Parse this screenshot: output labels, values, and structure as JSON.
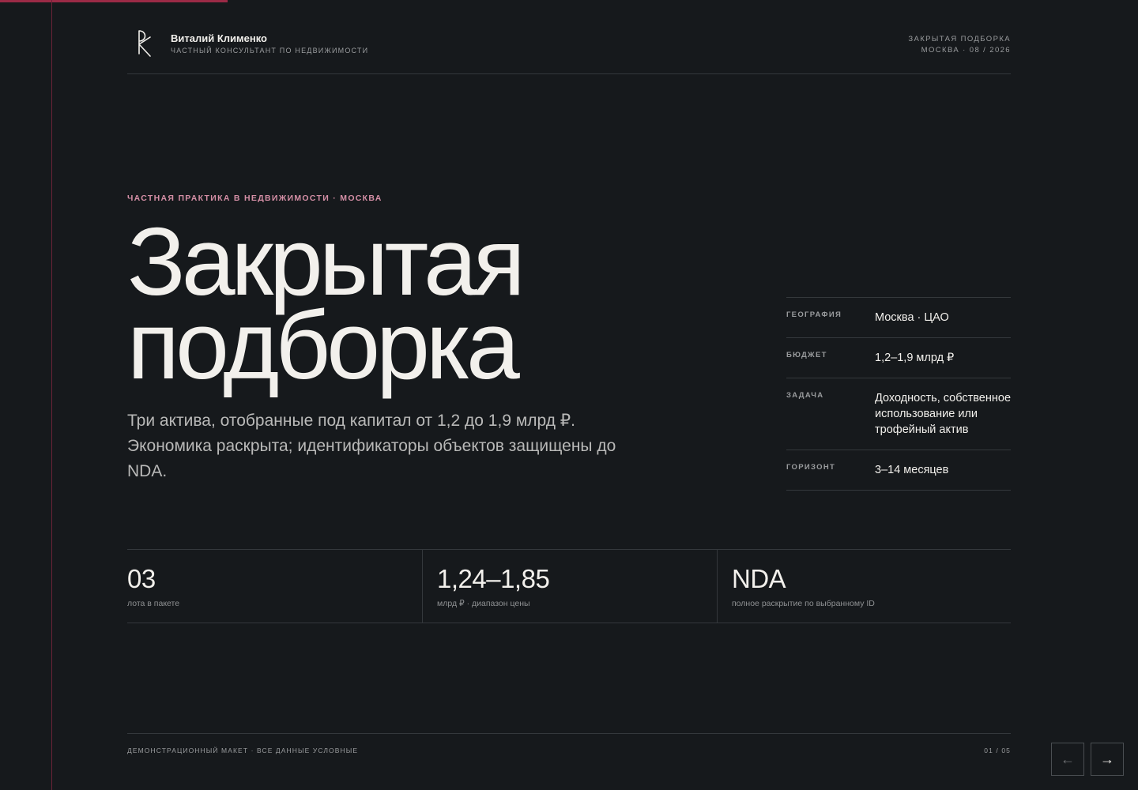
{
  "header": {
    "name": "Виталий Клименко",
    "subtitle": "частный консультант по недвижимости",
    "doc_title": "ЗАКРЫТАЯ ПОДБОРКА",
    "doc_meta": "МОСКВА · 08 / 2026"
  },
  "hero": {
    "eyebrow": "ЧАСТНАЯ ПРАКТИКА В НЕДВИЖИМОСТИ · МОСКВА",
    "title_line1": "Закрытая",
    "title_line2": "подборка",
    "lead": "Три актива, отобранные под капитал от 1,2 до 1,9 млрд ₽. Экономика раскрыта; идентификаторы объектов защищены до NDA."
  },
  "facts": [
    {
      "key": "ГЕОГРАФИЯ",
      "value": "Москва · ЦАО"
    },
    {
      "key": "БЮДЖЕТ",
      "value": "1,2–1,9 млрд ₽"
    },
    {
      "key": "ЗАДАЧА",
      "value": "Доходность, собственное использование или трофейный актив"
    },
    {
      "key": "ГОРИЗОНТ",
      "value": "3–14 месяцев"
    }
  ],
  "stats": [
    {
      "value": "03",
      "label": "лота в пакете"
    },
    {
      "value": "1,24–1,85",
      "label": "млрд ₽ · диапазон цены"
    },
    {
      "value": "NDA",
      "label": "полное раскрытие по выбранному ID"
    }
  ],
  "footer": {
    "note": "ДЕМОНСТРАЦИОННЫЙ МАКЕТ · ВСЕ ДАННЫЕ УСЛОВНЫЕ",
    "page": "01 / 05"
  },
  "nav": {
    "prev_icon": "arrow-left-icon",
    "next_icon": "arrow-right-icon",
    "prev_glyph": "←",
    "next_glyph": "→"
  },
  "progress": {
    "fraction": 0.2
  },
  "colors": {
    "background": "#16191c",
    "accent": "#9b2a46",
    "eyebrow": "#d58fa6",
    "text": "#f2f0ec",
    "muted": "#9a9c9e"
  }
}
